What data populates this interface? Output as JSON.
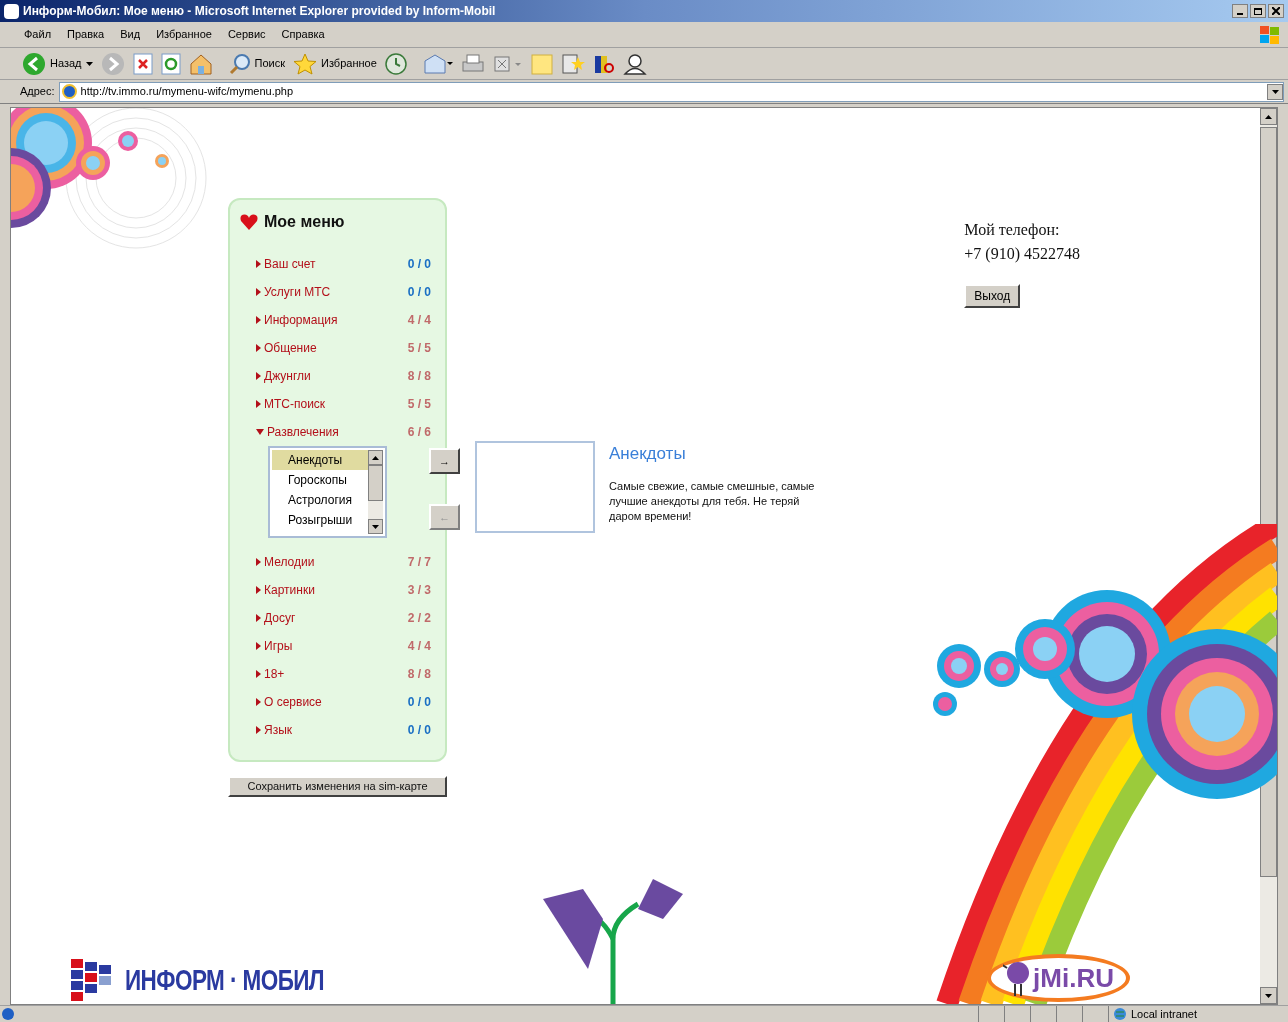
{
  "window": {
    "title": "Информ-Мобил: Мое меню - Microsoft Internet Explorer provided by Inform-Mobil"
  },
  "menu_bar": [
    "Файл",
    "Правка",
    "Вид",
    "Избранное",
    "Сервис",
    "Справка"
  ],
  "toolbar": {
    "back": "Назад",
    "search": "Поиск",
    "favorites": "Избранное"
  },
  "address_bar": {
    "label": "Адрес:",
    "url": "http://tv.immo.ru/mymenu-wifc/mymenu.php"
  },
  "my_menu": {
    "title": "Мое меню",
    "items": [
      {
        "label": "Ваш счет",
        "count": "0 / 0",
        "color": "#1a6fc4",
        "expanded": false
      },
      {
        "label": "Услуги МТС",
        "count": "0 / 0",
        "color": "#1a6fc4",
        "expanded": false
      },
      {
        "label": "Информация",
        "count": "4 / 4",
        "color": "#c06a6a",
        "expanded": false
      },
      {
        "label": "Общение",
        "count": "5 / 5",
        "color": "#c06a6a",
        "expanded": false
      },
      {
        "label": "Джунгли",
        "count": "8 / 8",
        "color": "#c06a6a",
        "expanded": false
      },
      {
        "label": "МТС-поиск",
        "count": "5 / 5",
        "color": "#c06a6a",
        "expanded": false
      },
      {
        "label": "Развлечения",
        "count": "6 / 6",
        "color": "#c06a6a",
        "expanded": true,
        "children": [
          {
            "label": "Анекдоты",
            "selected": true
          },
          {
            "label": "Гороскопы",
            "selected": false
          },
          {
            "label": "Астрология",
            "selected": false
          },
          {
            "label": "Розыгрыши",
            "selected": false
          }
        ]
      },
      {
        "label": "Мелодии",
        "count": "7 / 7",
        "color": "#c06a6a",
        "expanded": false
      },
      {
        "label": "Картинки",
        "count": "3 / 3",
        "color": "#c06a6a",
        "expanded": false
      },
      {
        "label": "Досуг",
        "count": "2 / 2",
        "color": "#c06a6a",
        "expanded": false
      },
      {
        "label": "Игры",
        "count": "4 / 4",
        "color": "#c06a6a",
        "expanded": false
      },
      {
        "label": "18+",
        "count": "8 / 8",
        "color": "#c06a6a",
        "expanded": false
      },
      {
        "label": "О сервисе",
        "count": "0 / 0",
        "color": "#1a6fc4",
        "expanded": false
      },
      {
        "label": "Язык",
        "count": "0 / 0",
        "color": "#1a6fc4",
        "expanded": false
      }
    ]
  },
  "arrow_buttons": [
    {
      "label": "→",
      "disabled": false
    },
    {
      "label": "←",
      "disabled": true
    }
  ],
  "preview": {
    "title": "Анекдоты",
    "description": "Самые свежие, самые смешные, самые лучшие анекдоты для тебя. Не теряй даром времени!"
  },
  "phone": {
    "label": "Мой телефон:",
    "number": "+7 (910) 4522748"
  },
  "logout_button": "Выход",
  "save_button": "Сохранить изменения на sim-карте",
  "logo": "ИНФОРМ · МОБИЛ",
  "partner_logo": "jMi.RU",
  "status_bar": {
    "zone": "Local intranet"
  }
}
